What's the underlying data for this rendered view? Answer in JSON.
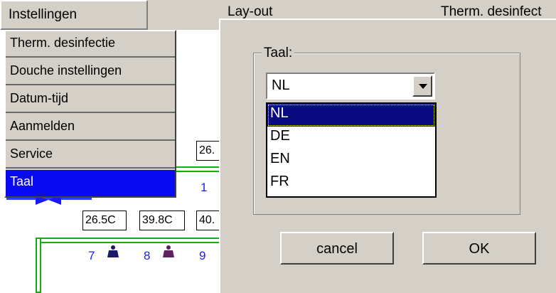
{
  "menubar": {
    "instellingen_label": "Instellingen",
    "layout_label": "Lay-out",
    "therm_label": "Therm. desinfect"
  },
  "menu": {
    "items": [
      {
        "label": "Therm. desinfectie"
      },
      {
        "label": "Douche instellingen"
      },
      {
        "label": "Datum-tijd"
      },
      {
        "label": "Aanmelden"
      },
      {
        "label": "Service"
      },
      {
        "label": "Taal",
        "active": true
      }
    ]
  },
  "schematic": {
    "temps": [
      "26.",
      "26.5C",
      "39.8C",
      "40."
    ],
    "numbers": [
      "1",
      "7",
      "8",
      "9"
    ]
  },
  "dialog": {
    "group_title": "Taal:",
    "selected_language": "NL",
    "options": [
      "NL",
      "DE",
      "EN",
      "FR"
    ],
    "cancel_label": "cancel",
    "ok_label": "OK"
  },
  "colors": {
    "menu_highlight": "#0a0af0",
    "list_selection": "#0a0a80",
    "pipe_green": "#10b010",
    "number_blue": "#1a1aff"
  }
}
